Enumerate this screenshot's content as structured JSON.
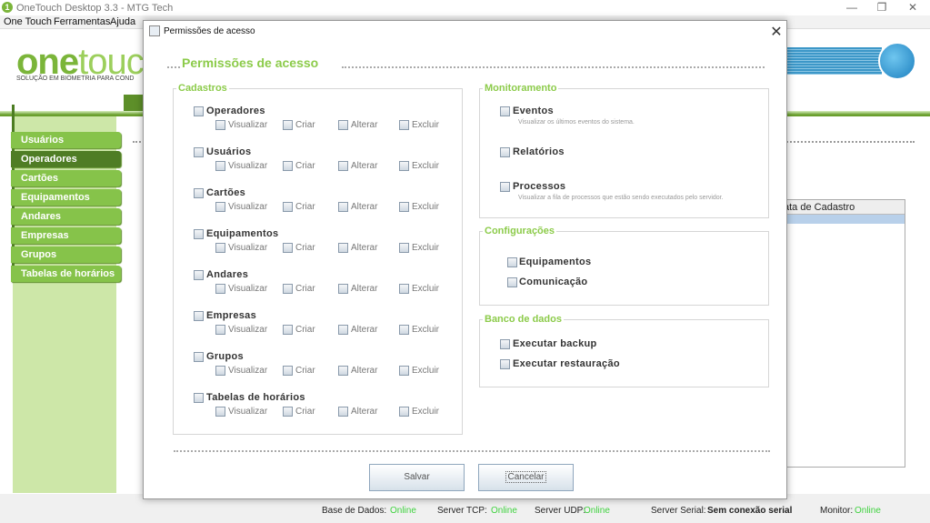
{
  "window": {
    "title": "OneTouch Desktop 3.3 - MTG Tech",
    "icon": "1",
    "minimize": "—",
    "restore": "❐",
    "close": "✕"
  },
  "menu": [
    "One Touch",
    "Ferramentas",
    "Ajuda"
  ],
  "logo": {
    "text_bold": "one",
    "text_light": "touch",
    "slogan": "SOLUÇÃO EM BIOMETRIA PARA COND"
  },
  "sidebar": {
    "items": [
      "Usuários",
      "Operadores",
      "Cartões",
      "Equipamentos",
      "Andares",
      "Empresas",
      "Grupos",
      "Tabelas de horários"
    ],
    "active": "Operadores"
  },
  "background_table": {
    "header": "ata de Cadastro"
  },
  "status": {
    "db_label": "Base de Dados:",
    "db": "Online",
    "tcp_label": "Server TCP:",
    "tcp": "Online",
    "udp_label": "Server UDP:",
    "udp": "Online",
    "serial_label": "Server Serial:",
    "serial": "Sem conexão serial",
    "monitor_label": "Monitor:",
    "monitor": "Online"
  },
  "colors": {
    "accent": "#8ccb4a",
    "online": "#3fd23f",
    "sidebar": "#86c34a",
    "sidebar_active": "#4f7d25"
  },
  "dialog": {
    "title": "Permissões de acesso",
    "close_icon": "close-icon",
    "heading": "Permissões de acesso",
    "cadastros": {
      "legend": "Cadastros",
      "actions": [
        "Visualizar",
        "Criar",
        "Alterar",
        "Excluir"
      ],
      "groups": [
        "Operadores",
        "Usuários",
        "Cartões",
        "Equipamentos",
        "Andares",
        "Empresas",
        "Grupos",
        "Tabelas de horários"
      ]
    },
    "monitoramento": {
      "legend": "Monitoramento",
      "items": [
        {
          "label": "Eventos",
          "desc": "Visualizar os últimos eventos do sistema."
        },
        {
          "label": "Relatórios",
          "desc": ""
        },
        {
          "label": "Processos",
          "desc": "Visualizar a fila de processos que estão sendo executados pelo servidor."
        }
      ]
    },
    "configuracoes": {
      "legend": "Configurações",
      "items": [
        "Equipamentos",
        "Comunicação"
      ]
    },
    "banco": {
      "legend": "Banco de dados",
      "items": [
        "Executar backup",
        "Executar restauração"
      ]
    },
    "save": "Salvar",
    "cancel": "Cancelar"
  }
}
